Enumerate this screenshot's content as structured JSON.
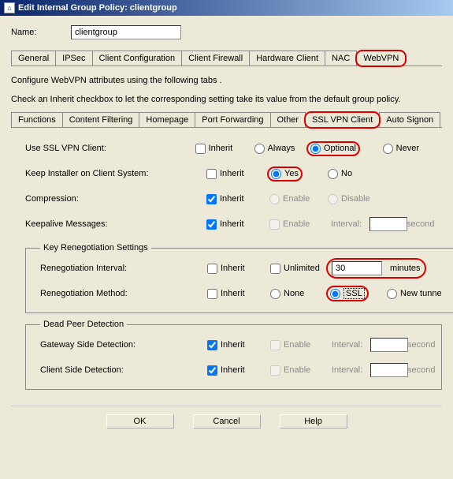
{
  "window": {
    "title": "Edit Internal Group Policy: clientgroup"
  },
  "name": {
    "label": "Name:",
    "value": "clientgroup"
  },
  "mainTabs": [
    "General",
    "IPSec",
    "Client Configuration",
    "Client Firewall",
    "Hardware Client",
    "NAC",
    "WebVPN"
  ],
  "mainActive": "WebVPN",
  "intro1": "Configure WebVPN attributes using the following tabs .",
  "intro2": "Check an Inherit checkbox to let the corresponding setting take its value from the default group policy.",
  "subTabs": [
    "Functions",
    "Content Filtering",
    "Homepage",
    "Port Forwarding",
    "Other",
    "SSL VPN Client",
    "Auto Signon"
  ],
  "subActive": "SSL VPN Client",
  "labels": {
    "inherit": "Inherit",
    "always": "Always",
    "optional": "Optional",
    "never": "Never",
    "yes": "Yes",
    "no": "No",
    "enable": "Enable",
    "disable": "Disable",
    "interval": "Interval:",
    "seconds": "second",
    "unlimited": "Unlimited",
    "minutes": "minutes",
    "none": "None",
    "ssl": "SSL",
    "newtunnel": "New tunne"
  },
  "rows": {
    "useSSL": "Use SSL VPN Client:",
    "keepInstaller": "Keep Installer on Client System:",
    "compression": "Compression:",
    "keepalive": "Keepalive Messages:",
    "keyGroup": "Key Renegotiation Settings",
    "renegInterval": "Renegotiation Interval:",
    "renegMethod": "Renegotiation Method:",
    "dpdGroup": "Dead Peer Detection",
    "gwSide": "Gateway Side Detection:",
    "clientSide": "Client Side Detection:"
  },
  "values": {
    "renegInterval": "30"
  },
  "buttons": {
    "ok": "OK",
    "cancel": "Cancel",
    "help": "Help"
  }
}
